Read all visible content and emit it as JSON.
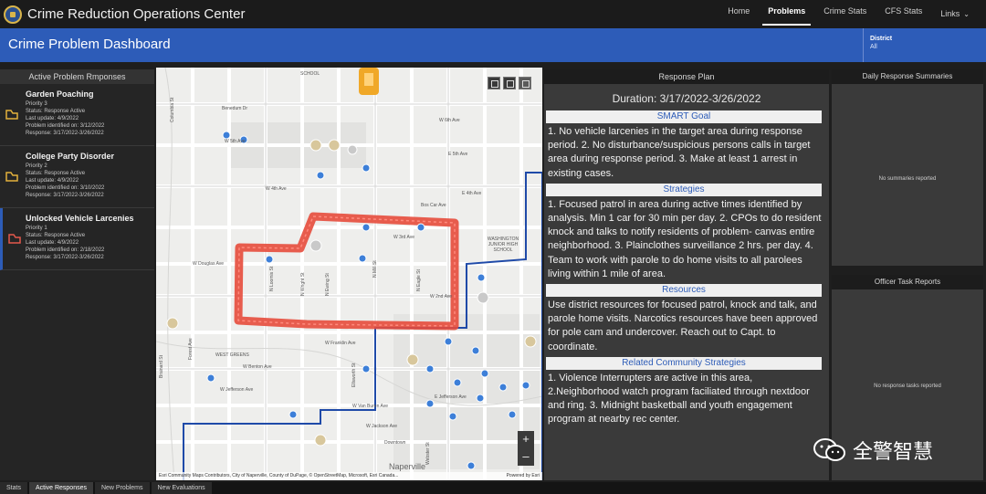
{
  "app": {
    "title": "Crime Reduction Operations Center"
  },
  "nav": [
    {
      "label": "Home",
      "active": false
    },
    {
      "label": "Problems",
      "active": true
    },
    {
      "label": "Crime Stats",
      "active": false
    },
    {
      "label": "CFS Stats",
      "active": false
    }
  ],
  "nav_links": {
    "label": "Links"
  },
  "header": {
    "title": "Crime Problem Dashboard",
    "district_label": "District",
    "district_value": "All"
  },
  "left_panel": {
    "title": "Active Problem Rmponses",
    "problems": [
      {
        "name": "Garden Poaching",
        "priority": "Priority 3",
        "status": "Status: Response Active",
        "last_update": "Last update: 4/9/2022",
        "identified": "Problem identified on: 3/12/2022",
        "response": "Response: 3/17/2022-3/26/2022",
        "color": "#e3b23c",
        "selected": false
      },
      {
        "name": "College Party Disorder",
        "priority": "Priority 2",
        "status": "Status: Response Active",
        "last_update": "Last update: 4/9/2022",
        "identified": "Problem identified on: 3/10/2022",
        "response": "Response: 3/17/2022-3/26/2022",
        "color": "#e3b23c",
        "selected": false
      },
      {
        "name": "Unlocked Vehicle Larcenies",
        "priority": "Priority 1",
        "status": "Status: Response Active",
        "last_update": "Last update: 4/9/2022",
        "identified": "Problem identified on: 2/18/2022",
        "response": "Response: 3/17/2022-3/26/2022",
        "color": "#e4584c",
        "selected": true
      }
    ]
  },
  "map": {
    "streets": [
      "Benedum Dr",
      "W 6th Ave",
      "W 5th Ave",
      "W 4th Ave",
      "E 5th Ave",
      "E 4th Ave",
      "W 3rd Ave",
      "W 2nd Ave",
      "Bos Car Ave",
      "W Douglas Ave",
      "W Franklin Ave",
      "W Benton Ave",
      "W Jefferson Ave",
      "E Jefferson Ave",
      "W Van Buren Ave",
      "W Jackson Ave",
      "N Ewing St",
      "N Mill St",
      "N Eagle St",
      "N Wright St",
      "N Loomis St",
      "Ellsworth St",
      "Columbia St",
      "Brainard St",
      "Forest Ave",
      "Webster St"
    ],
    "places": [
      "SCHOOL",
      "WASHINGTON JUNIOR HIGH SCHOOL",
      "WEST GREENS",
      "Downtown",
      "Naperville"
    ],
    "attribution": "Esri Community Maps Contributors, City of Naperville, County of DuPage, © OpenStreetMap, Microsoft, Esri Canada...",
    "attribution_right": "Powered by Esri",
    "zoom_in": "+",
    "zoom_out": "–",
    "highlight_color": "#e64b3c",
    "boundary_color": "#1f4aa8"
  },
  "plan": {
    "title": "Response Plan",
    "duration": "Duration: 3/17/2022-3/26/2022",
    "sections": [
      {
        "title": "SMART Goal",
        "text": "1. No vehicle larcenies in the target area during response period. 2. No disturbance/suspicious persons calls in target area during response period. 3. Make at least 1 arrest in existing cases."
      },
      {
        "title": "Strategies",
        "text": "1. Focused patrol in area during active times identified by analysis. Min 1 car for 30 min per day. 2. CPOs to do resident knock and talks to notify residents of problem- canvas entire neighborhood. 3. Plainclothes surveillance 2 hrs. per day. 4. Team to work with parole to do home visits to all parolees living within 1 mile of area."
      },
      {
        "title": "Resources",
        "text": "Use district resources for focused patrol, knock and talk, and parole home visits. Narcotics resources have been approved for pole cam and undercover. Reach out to Capt. to coordinate."
      },
      {
        "title": "Related Community Strategies",
        "text": "1. Violence Interrupters are active in this area, 2.Neighborhood watch program faciliated through nextdoor and ring. 3. Midnight basketball and youth engagement program at nearby rec center."
      }
    ]
  },
  "daily": {
    "title": "Daily Response Summaries",
    "empty": "No summaries reported"
  },
  "officer": {
    "title": "Officer Task Reports",
    "empty": "No response tasks reported"
  },
  "tabs": [
    {
      "label": "Stats",
      "active": false
    },
    {
      "label": "Active Responses",
      "active": true
    },
    {
      "label": "New Problems",
      "active": false
    },
    {
      "label": "New Evaluations",
      "active": false
    }
  ],
  "watermark": {
    "text": "全警智慧"
  }
}
